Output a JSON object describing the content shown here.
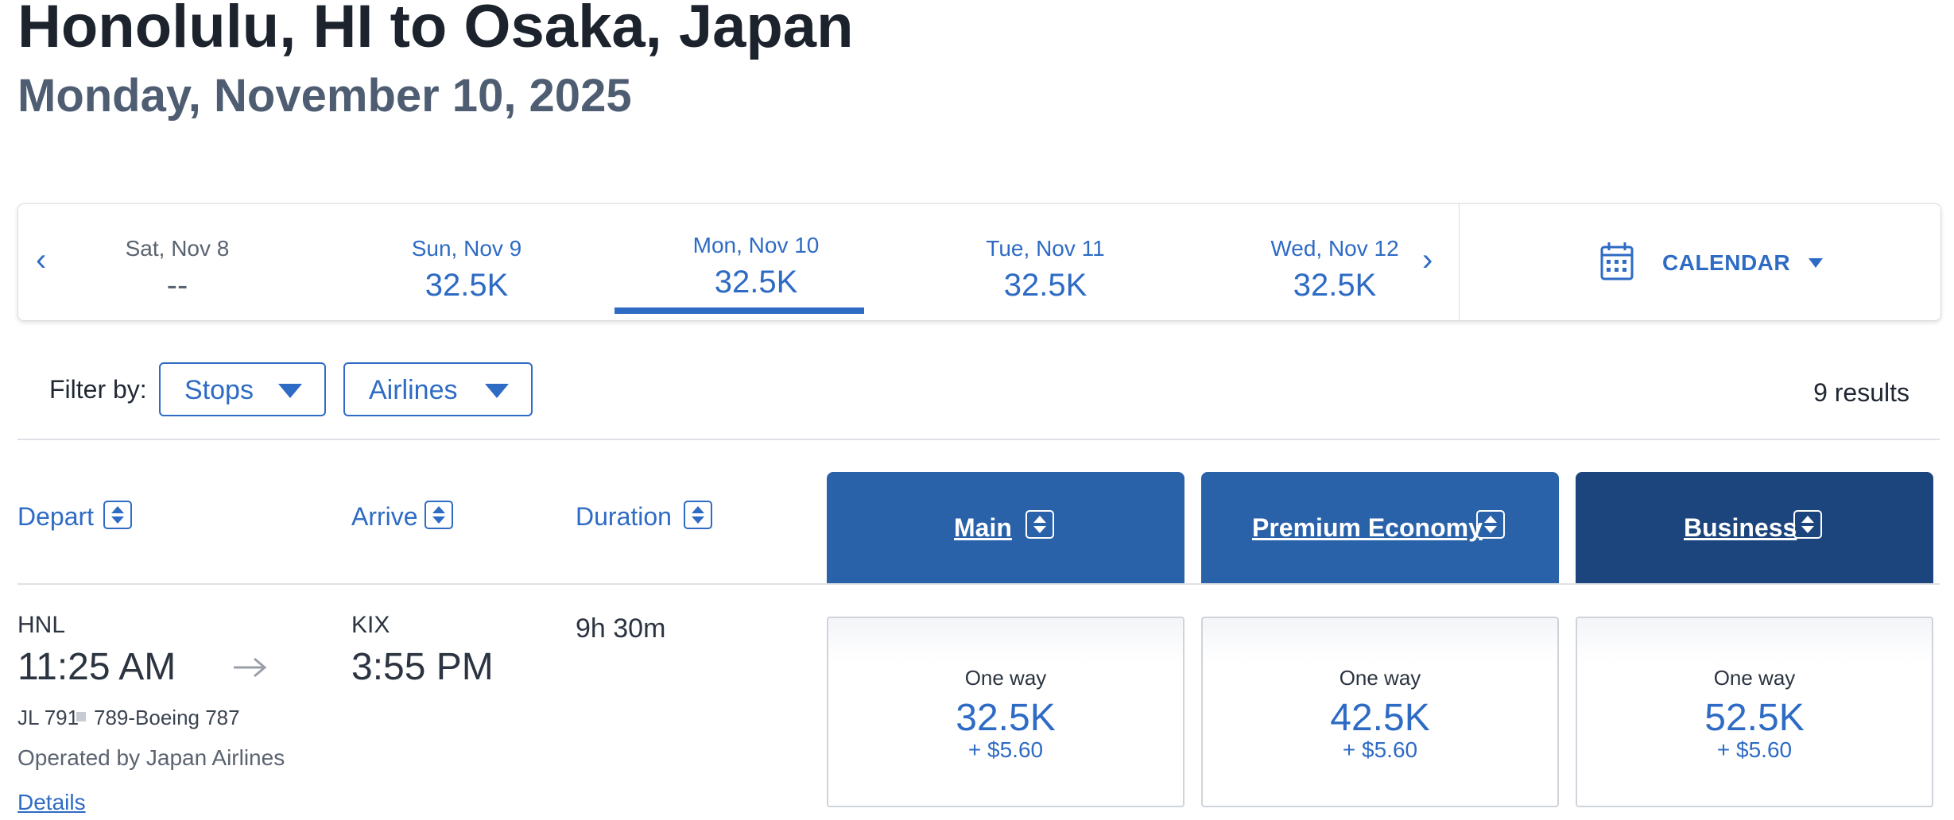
{
  "header": {
    "title": "Honolulu, HI to Osaka, Japan",
    "subtitle": "Monday, November 10, 2025"
  },
  "date_strip": {
    "prev_arrow": "‹",
    "next_arrow": "›",
    "dates": [
      {
        "label": "Sat, Nov 8",
        "price": "--",
        "selected": false
      },
      {
        "label": "Sun, Nov 9",
        "price": "32.5K",
        "selected": false
      },
      {
        "label": "Mon, Nov 10",
        "price": "32.5K",
        "selected": true
      },
      {
        "label": "Tue, Nov 11",
        "price": "32.5K",
        "selected": false
      },
      {
        "label": "Wed, Nov 12",
        "price": "32.5K",
        "selected": false
      }
    ],
    "calendar_label": "CALENDAR",
    "calendar_icon": "calendar-icon"
  },
  "filters": {
    "label": "Filter by:",
    "stops_label": "Stops",
    "airlines_label": "Airlines",
    "results": "9 results"
  },
  "columns": {
    "depart": "Depart",
    "arrive": "Arrive",
    "duration": "Duration",
    "cabins": [
      {
        "label": "Main",
        "color": "#2a62aa"
      },
      {
        "label": "Premium Economy",
        "color": "#2a62aa"
      },
      {
        "label": "Business",
        "color": "#1c457e"
      }
    ]
  },
  "flight": {
    "depart_code": "HNL",
    "depart_time": "11:25 AM",
    "arrive_code": "KIX",
    "arrive_time": "3:55 PM",
    "duration": "9h 30m",
    "flight_number": "JL 791",
    "aircraft": "789-Boeing 787",
    "operated_by": "Operated by Japan Airlines",
    "details_link": "Details",
    "fares": [
      {
        "label": "One way",
        "points": "32.5K",
        "fee": "+ $5.60"
      },
      {
        "label": "One way",
        "points": "42.5K",
        "fee": "+ $5.60"
      },
      {
        "label": "One way",
        "points": "52.5K",
        "fee": "+ $5.60"
      }
    ]
  },
  "colors": {
    "accent": "#2e6bc4",
    "text": "#1f2833",
    "subtitle": "#4e5d72",
    "muted_date": "#5a6370"
  }
}
